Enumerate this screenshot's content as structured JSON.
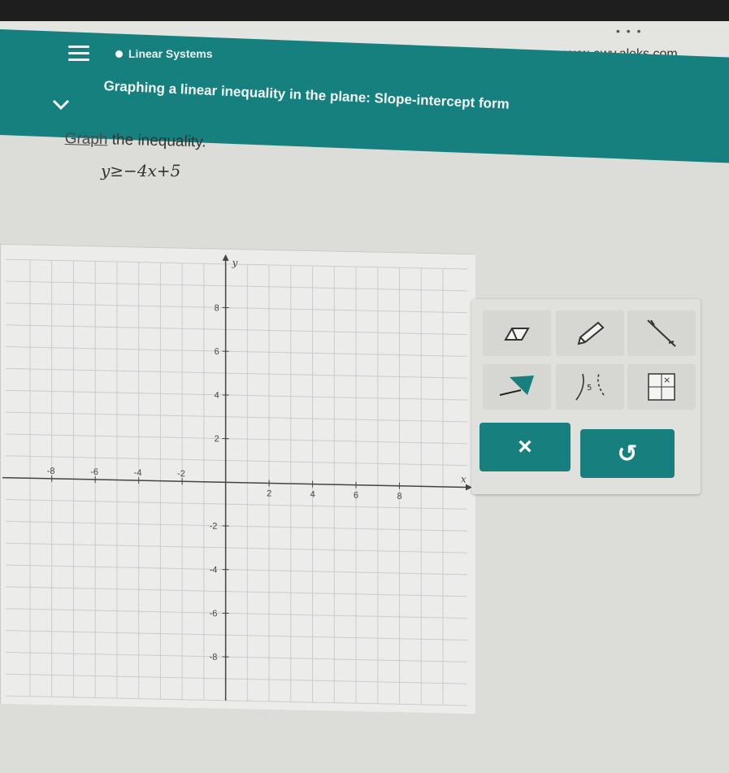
{
  "browser": {
    "url": "www-awy.aleks.com",
    "more_icon": "ellipsis-icon"
  },
  "header": {
    "menu_icon": "hamburger-icon",
    "topic": "Linear Systems",
    "lesson_title": "Graphing a linear inequality in the plane: Slope-intercept form",
    "expand_icon": "chevron-down-icon"
  },
  "question": {
    "prompt_link": "Graph",
    "prompt_rest": " the inequality.",
    "equation": "y≥−4x+5"
  },
  "graph": {
    "x_label": "x",
    "y_label": "y",
    "x_ticks": [
      "-8",
      "-6",
      "-4",
      "-2",
      "2",
      "4",
      "6",
      "8"
    ],
    "y_ticks": [
      "8",
      "6",
      "4",
      "2",
      "-2",
      "-4",
      "-6",
      "-8"
    ],
    "x_range": [
      -9,
      10
    ],
    "y_range": [
      -10,
      10
    ]
  },
  "tools": [
    {
      "name": "eraser-tool",
      "icon": "eraser-icon"
    },
    {
      "name": "pencil-tool",
      "icon": "pencil-icon"
    },
    {
      "name": "line-tool",
      "icon": "line-segment-icon"
    },
    {
      "name": "shade-tool",
      "icon": "flag-shade-icon"
    },
    {
      "name": "dashed-curve-tool",
      "icon": "dashed-curve-icon"
    },
    {
      "name": "no-solution-tool",
      "icon": "grid-x-icon"
    }
  ],
  "actions": {
    "clear_label": "×",
    "undo_label": "↺"
  },
  "colors": {
    "header_teal": "#16807f",
    "action_teal": "#17807f",
    "grid_line": "#c9cdd0"
  }
}
